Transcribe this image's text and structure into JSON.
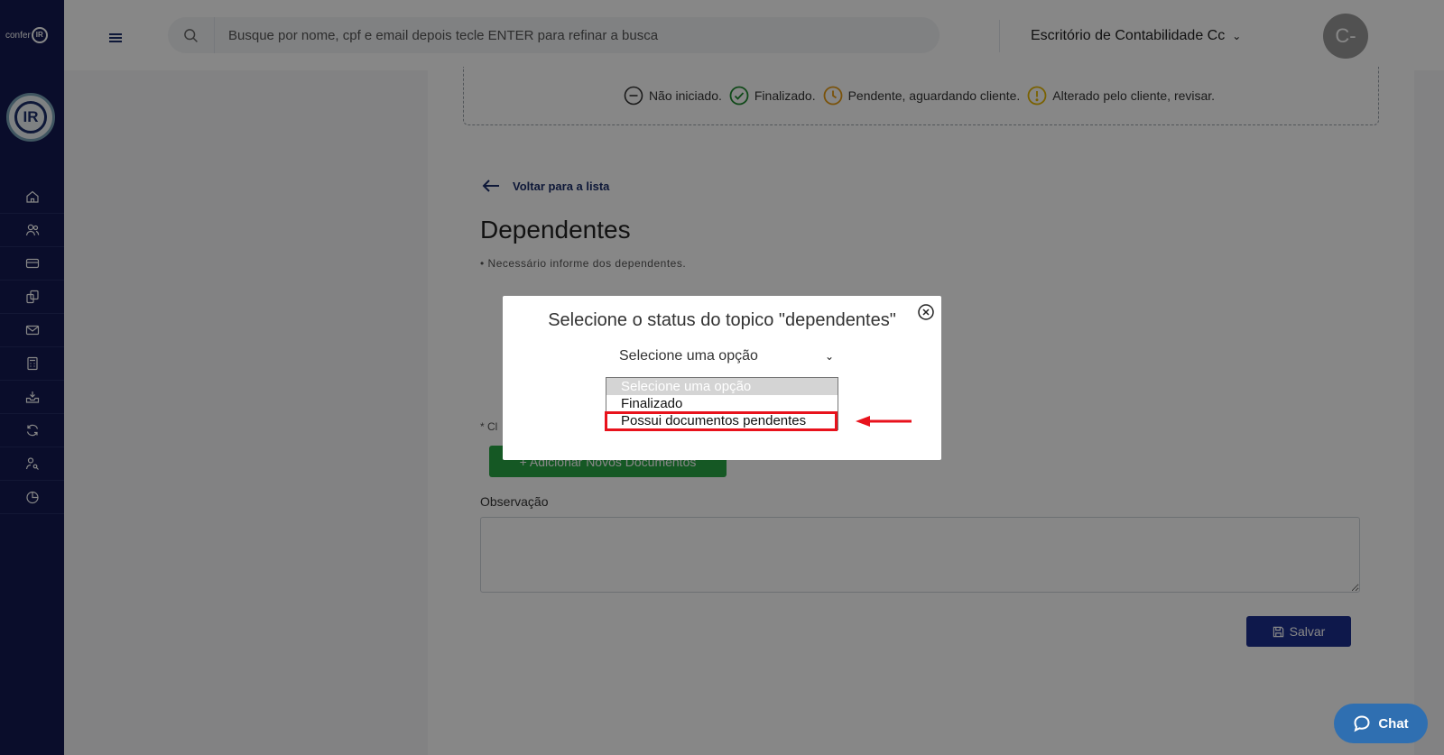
{
  "brand": {
    "name": "confer",
    "mark": "IR",
    "logo_text": "IR"
  },
  "sidebar": {
    "items": [
      {
        "icon": "home-icon"
      },
      {
        "icon": "users-icon"
      },
      {
        "icon": "card-icon"
      },
      {
        "icon": "documents-icon"
      },
      {
        "icon": "mail-icon"
      },
      {
        "icon": "calculator-icon"
      },
      {
        "icon": "inbox-icon"
      },
      {
        "icon": "sync-icon"
      },
      {
        "icon": "user-key-icon"
      },
      {
        "icon": "pie-chart-icon"
      }
    ]
  },
  "topbar": {
    "search_placeholder": "Busque por nome, cpf e email depois tecle ENTER para refinar a busca",
    "office": "Escritório de Contabilidade Cc",
    "avatar_initial": "C-"
  },
  "legend": {
    "items": [
      {
        "label": "Não iniciado.",
        "icon": "minus-circle-icon",
        "color": "#333333"
      },
      {
        "label": "Finalizado.",
        "icon": "check-circle-icon",
        "color": "#1e8a2e"
      },
      {
        "label": "Pendente, aguardando cliente.",
        "icon": "clock-icon",
        "color": "#e69b14"
      },
      {
        "label": "Alterado pelo cliente, revisar.",
        "icon": "alert-circle-icon",
        "color": "#e6b800"
      }
    ]
  },
  "main": {
    "back_label": "Voltar para a lista",
    "title": "Dependentes",
    "subtitle": "• Necessário informe dos dependentes.",
    "click_hint": "* Cl",
    "add_docs_label": "+ Adicionar Novos Documentos",
    "observation_label": "Observação",
    "save_label": "Salvar"
  },
  "modal": {
    "title": "Selecione o status do topico \"dependentes\"",
    "selected_value": "Selecione uma opção",
    "options": [
      "Selecione uma opção",
      "Finalizado",
      "Possui documentos pendentes"
    ]
  },
  "chat": {
    "label": "Chat"
  },
  "colors": {
    "sidebar": "#131a52",
    "primary": "#1c2f8e",
    "success": "#28a745",
    "highlight": "#e8121c",
    "chat": "#2f6fb1"
  }
}
